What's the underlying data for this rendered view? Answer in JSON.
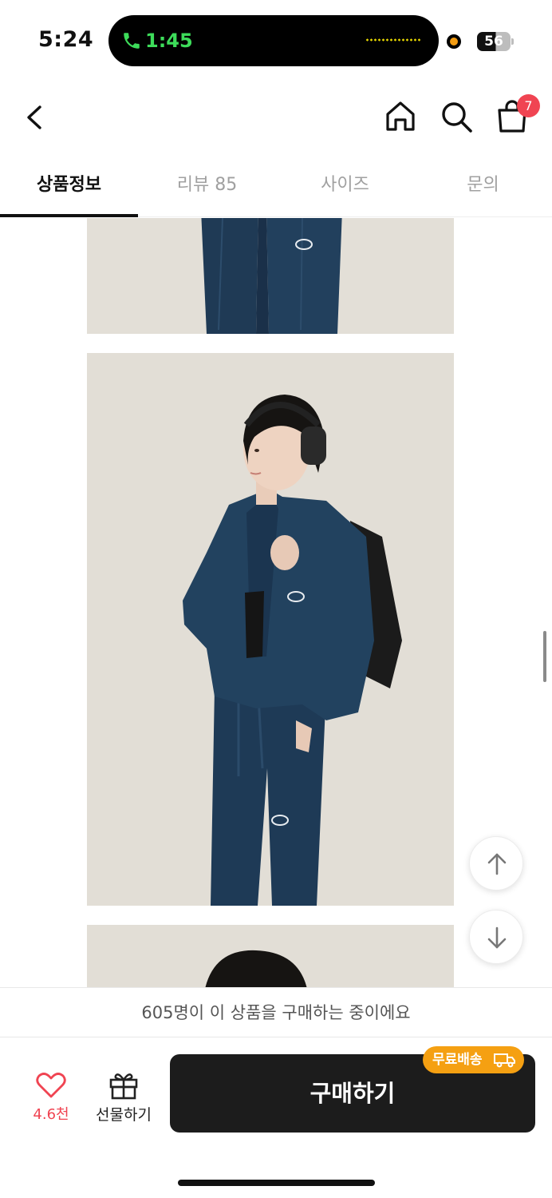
{
  "status_bar": {
    "time": "5:24",
    "call_time": "1:45",
    "battery": "56"
  },
  "header": {
    "cart_count": "7"
  },
  "tabs": [
    {
      "label": "상품정보",
      "active": true
    },
    {
      "label": "리뷰 85",
      "active": false
    },
    {
      "label": "사이즈",
      "active": false
    },
    {
      "label": "문의",
      "active": false
    }
  ],
  "buyer_notice": "605명이 이 상품을 구매하는 중이에요",
  "bottom_bar": {
    "like_count": "4.6천",
    "gift_label": "선물하기",
    "buy_label": "구매하기",
    "free_shipping_label": "무료배송"
  },
  "colors": {
    "accent_red": "#f04452",
    "ship_orange": "#f5a012",
    "buy_button": "#1c1c1c"
  }
}
